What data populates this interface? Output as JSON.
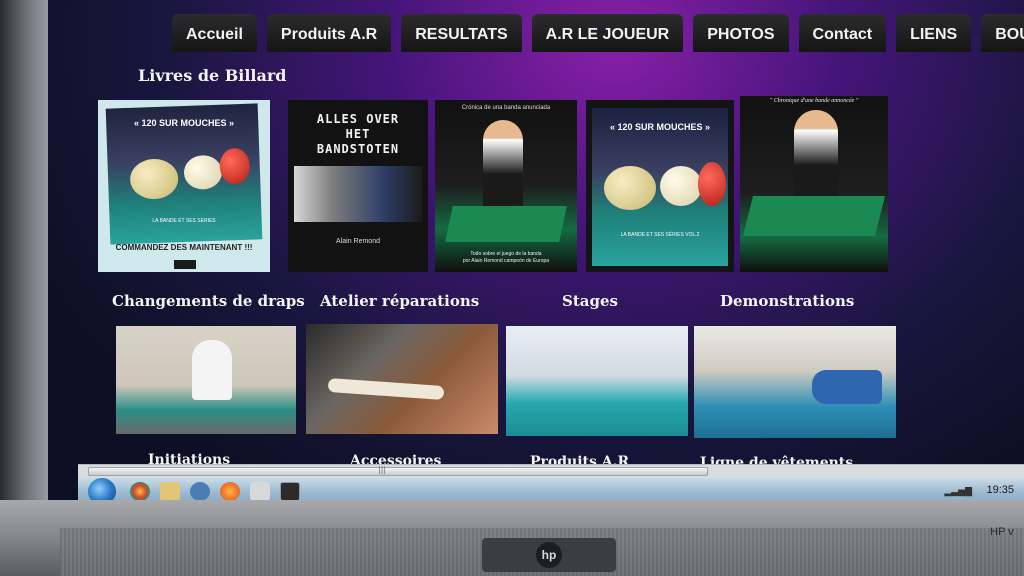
{
  "nav": {
    "items": [
      "Accueil",
      "Produits A.R",
      "RESULTATS",
      "A.R LE JOUEUR",
      "PHOTOS",
      "Contact",
      "LIENS",
      "BOUTIQU"
    ]
  },
  "books_section": {
    "title": "Livres  de Billard",
    "book1": {
      "title": "« 120 SUR MOUCHES »",
      "sub": "LA BANDE ET SES SERIES",
      "order": "COMMANDEZ DES MAINTENANT !!!"
    },
    "book2": {
      "title": "ALLES OVER\nHET\nBANDSTOTEN",
      "author": "Alain Remond"
    },
    "book3": {
      "title": "Crónica de una banda anunciada",
      "bottom": "Todo sobre el juego de la banda\npor Alain Remond  campeón de Europa"
    },
    "book4": {
      "title": "« 120 SUR MOUCHES »",
      "sub": "LA BANDE ET SES SÉRIES  VOL.2"
    },
    "book5": {
      "title": "\" Chronique d'une bande annoncée \""
    }
  },
  "services": [
    {
      "label": "Changements de draps"
    },
    {
      "label": "Atelier réparations"
    },
    {
      "label": "Stages"
    },
    {
      "label": "Demonstrations"
    }
  ],
  "bottom_labels": [
    "Initiations",
    "Accessoires",
    "Produits A.R",
    "Ligne de vêtements"
  ],
  "taskbar": {
    "time": "19:35",
    "signal": "▂▃▅▇"
  },
  "monitor": {
    "brand": "hp",
    "brand_text": "HP v"
  },
  "colors": {
    "page_bg_accent": "#8a1fa8",
    "nav_bg": "#1e1e1f",
    "felt": "#2aa39e"
  }
}
